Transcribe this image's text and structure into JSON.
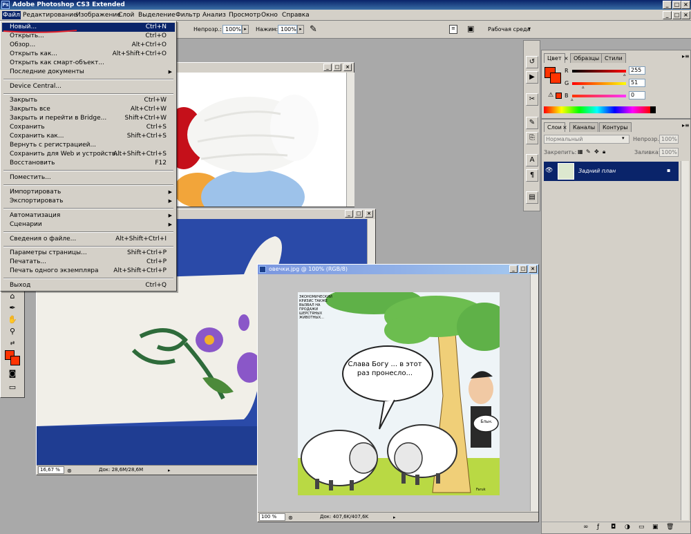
{
  "app": {
    "title": "Adobe Photoshop CS3 Extended",
    "logo": "Ps"
  },
  "menubar": [
    "Файл",
    "Редактирование",
    "Изображение",
    "Слой",
    "Выделение",
    "Фильтр",
    "Анализ",
    "Просмотр",
    "Окно",
    "Справка"
  ],
  "options": {
    "opacity_label": "Непрозр.:",
    "opacity_value": "100%",
    "press_label": "Нажим:",
    "press_value": "100%",
    "workspace_label": "Рабочая среда"
  },
  "file_menu": {
    "items": [
      {
        "label": "Новый...",
        "shortcut": "Ctrl+N"
      },
      {
        "label": "Открыть...",
        "shortcut": "Ctrl+O"
      },
      {
        "label": "Обзор...",
        "shortcut": "Alt+Ctrl+O"
      },
      {
        "label": "Открыть как...",
        "shortcut": "Alt+Shift+Ctrl+O"
      },
      {
        "label": "Открыть как смарт-объект...",
        "shortcut": ""
      },
      {
        "label": "Последние документы",
        "shortcut": ""
      },
      {
        "label": "Device Central...",
        "shortcut": ""
      },
      {
        "label": "Закрыть",
        "shortcut": "Ctrl+W"
      },
      {
        "label": "Закрыть все",
        "shortcut": "Alt+Ctrl+W"
      },
      {
        "label": "Закрыть и перейти в Bridge...",
        "shortcut": "Shift+Ctrl+W"
      },
      {
        "label": "Сохранить",
        "shortcut": "Ctrl+S"
      },
      {
        "label": "Сохранить как...",
        "shortcut": "Shift+Ctrl+S"
      },
      {
        "label": "Вернуть с регистрацией...",
        "shortcut": ""
      },
      {
        "label": "Сохранить для Web и устройств...",
        "shortcut": "Alt+Shift+Ctrl+S"
      },
      {
        "label": "Восстановить",
        "shortcut": "F12"
      },
      {
        "label": "Поместить...",
        "shortcut": ""
      },
      {
        "label": "Импортировать",
        "shortcut": ""
      },
      {
        "label": "Экспортировать",
        "shortcut": ""
      },
      {
        "label": "Автоматизация",
        "shortcut": ""
      },
      {
        "label": "Сценарии",
        "shortcut": ""
      },
      {
        "label": "Сведения о файле...",
        "shortcut": "Alt+Shift+Ctrl+I"
      },
      {
        "label": "Параметры страницы...",
        "shortcut": "Shift+Ctrl+P"
      },
      {
        "label": "Печатать...",
        "shortcut": "Ctrl+P"
      },
      {
        "label": "Печать одного экземпляра",
        "shortcut": "Alt+Shift+Ctrl+P"
      },
      {
        "label": "Выход",
        "shortcut": "Ctrl+Q"
      }
    ]
  },
  "doc_wool": {
    "title": ""
  },
  "doc_mitten": {
    "title": "",
    "zoom": "16,67 %",
    "info": "Док: 28,6M/28,6M"
  },
  "doc_sheep": {
    "title": "овечки.jpg @ 100% (RGB/8)",
    "zoom": "100 %",
    "info": "Док: 407,6K/407,6K"
  },
  "cartoon": {
    "speech": "Слава Богу ... в этот раз пронесло...",
    "thought": "Бльн.",
    "sign": "ЭКОНОМИЧЕСКИЙ КРИЗИС ТАКЖЕ ВЫЗВАЛ НА ПРОДАЖИ ШЕРСТЯНЫХ ЖИВОТНЫХ...",
    "signature": "Faruk"
  },
  "color_panel": {
    "tabs": [
      "Цвет",
      "Образцы",
      "Стили"
    ],
    "r_label": "R",
    "r_value": "255",
    "g_label": "G",
    "g_value": "51",
    "b_label": "B",
    "b_value": "0",
    "fg_color": "#ff3300"
  },
  "layers_panel": {
    "tabs": [
      "Слои",
      "Каналы",
      "Контуры"
    ],
    "blend_mode": "Нормальный",
    "opacity_label": "Непрозр.:",
    "opacity_value": "100%",
    "lock_label": "Закрепить:",
    "fill_label": "Заливка:",
    "fill_value": "100%",
    "layer_name": "Задний план"
  }
}
